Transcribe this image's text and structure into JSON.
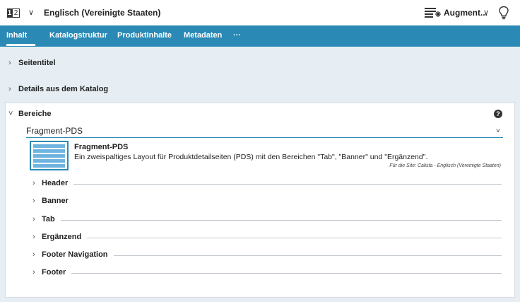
{
  "topbar": {
    "lang_icon_a": "1",
    "lang_icon_b": "2",
    "chevron": "∨",
    "language": "Englisch (Vereinigte Staaten)",
    "augment_label": "Augment...",
    "augment_chevron": "∨"
  },
  "tabs": [
    "Inhalt",
    "Katalogstruktur",
    "Produktinhalte",
    "Metadaten",
    "···"
  ],
  "panels": {
    "seitentitel": "Seitentitel",
    "details": "Details aus dem Katalog",
    "bereiche": "Bereiche"
  },
  "arrows": {
    "collapsed": "›",
    "expanded": "˅"
  },
  "help": "?",
  "combo": {
    "value": "Fragment-PDS",
    "arrow": "˅"
  },
  "option": {
    "title": "Fragment-PDS",
    "description": "Ein zweispaltiges Layout für Produktdetailseiten (PDS) mit den Bereichen \"Tab\", \"Banner\" und \"Ergänzend\".",
    "site": "Für die Site: Calista - Englisch (Vereinigte Staaten)"
  },
  "sections": [
    "Header",
    "Banner",
    "Tab",
    "Ergänzend",
    "Footer Navigation",
    "Footer"
  ],
  "colors": {
    "accent": "#2a8ab5",
    "background": "#e6eef3"
  }
}
